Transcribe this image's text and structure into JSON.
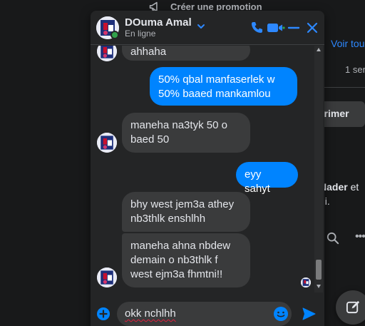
{
  "background": {
    "promo_label": "Créer une promotion",
    "see_all_link": "Voir tou",
    "time_text": "1 sen",
    "delete_button": "primer",
    "name_bold": "Nader",
    "name_suffix": " et",
    "name_line2": "ui."
  },
  "chat": {
    "contact_name": "DOuma Amal",
    "status": "En ligne",
    "messages": [
      {
        "dir": "in",
        "text": "ahhaha"
      },
      {
        "dir": "out",
        "text": "50% qbal manfaserlek w 50% baaed mankamlou"
      },
      {
        "dir": "in",
        "text": "maneha na3tyk 50 o baed 50"
      },
      {
        "dir": "out",
        "text": "eyy sahyt"
      },
      {
        "dir": "in",
        "text": "bhy west jem3a athey nb3thlk enshlhh"
      },
      {
        "dir": "in",
        "text": "maneha ahna nbdew demain o nb3thlk f west ejm3a fhmtni!!"
      }
    ],
    "composer_value": "okk nchlhh"
  },
  "colors": {
    "accent": "#0084ff",
    "incoming_bubble": "#3a3b3c",
    "panel": "#242526",
    "online": "#31a24c"
  },
  "icons": [
    "megaphone-icon",
    "chevron-down-icon",
    "phone-icon",
    "video-icon",
    "minimize-icon",
    "close-icon",
    "plus-icon",
    "emoji-icon",
    "send-icon",
    "search-icon",
    "more-icon",
    "compose-icon"
  ]
}
